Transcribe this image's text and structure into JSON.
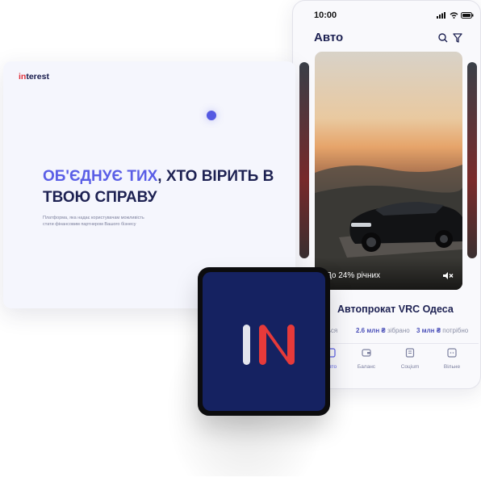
{
  "phone": {
    "time": "10:00",
    "title": "Авто",
    "hero_label": "До 24% річних",
    "project_title": "Автопрокат VRC Одеса",
    "stats": [
      {
        "prefix": "",
        "value": "",
        "label": "ється"
      },
      {
        "prefix": "",
        "value": "2.6 млн ₴",
        "label": " зібрано"
      },
      {
        "prefix": "",
        "value": "3 млн ₴",
        "label": " потрібно"
      }
    ],
    "nav": [
      {
        "label": "Авто",
        "icon": "home-icon"
      },
      {
        "label": "Баланс",
        "icon": "wallet-icon"
      },
      {
        "label": "Соцium",
        "icon": "news-icon"
      },
      {
        "label": "Вільне",
        "icon": "grid-icon"
      }
    ]
  },
  "landing": {
    "logo": {
      "accent": "in",
      "rest": "terest"
    },
    "headline": {
      "accent": "ОБ'ЄДНУЄ ТИХ",
      "rest": ", ХТО ВІРИТЬ В ТВОЮ СПРАВУ"
    },
    "subtitle": "Платформа, яка надає користувачам можливість стати фінансовим партнером Вашого бізнесу"
  },
  "app_icon": {
    "letters": "IN"
  },
  "colors": {
    "accent": "#5a5ee6",
    "navy": "#1d2152",
    "brand_red": "#e0303a",
    "icon_bg": "#152261"
  }
}
